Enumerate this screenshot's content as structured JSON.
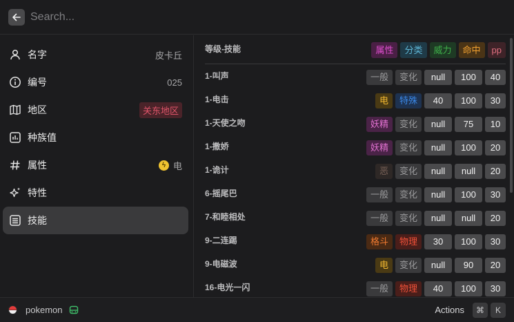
{
  "search": {
    "placeholder": "Search..."
  },
  "left": {
    "items": [
      {
        "label": "名字",
        "value": "皮卡丘",
        "icon": "person-icon"
      },
      {
        "label": "编号",
        "value": "025",
        "icon": "info-icon"
      },
      {
        "label": "地区",
        "value": "关东地区",
        "icon": "map-icon"
      },
      {
        "label": "种族值",
        "value": "",
        "icon": "stats-icon"
      },
      {
        "label": "属性",
        "value": "电",
        "icon": "hash-icon"
      },
      {
        "label": "特性",
        "value": "",
        "icon": "sparkle-icon"
      },
      {
        "label": "技能",
        "value": "",
        "icon": "list-icon"
      }
    ]
  },
  "moves": {
    "header": {
      "title": "等级-技能",
      "tags": [
        "属性",
        "分类",
        "威力",
        "命中",
        "pp"
      ]
    },
    "rows": [
      {
        "name": "1-叫声",
        "type": "一般",
        "category": "变化",
        "power": "null",
        "accuracy": "100",
        "pp": "40"
      },
      {
        "name": "1-电击",
        "type": "电",
        "category": "特殊",
        "power": "40",
        "accuracy": "100",
        "pp": "30"
      },
      {
        "name": "1-天使之吻",
        "type": "妖精",
        "category": "变化",
        "power": "null",
        "accuracy": "75",
        "pp": "10"
      },
      {
        "name": "1-撒娇",
        "type": "妖精",
        "category": "变化",
        "power": "null",
        "accuracy": "100",
        "pp": "20"
      },
      {
        "name": "1-诡计",
        "type": "恶",
        "category": "变化",
        "power": "null",
        "accuracy": "null",
        "pp": "20"
      },
      {
        "name": "6-摇尾巴",
        "type": "一般",
        "category": "变化",
        "power": "null",
        "accuracy": "100",
        "pp": "30"
      },
      {
        "name": "7-和睦相处",
        "type": "一般",
        "category": "变化",
        "power": "null",
        "accuracy": "null",
        "pp": "20"
      },
      {
        "name": "9-二连踢",
        "type": "格斗",
        "category": "物理",
        "power": "30",
        "accuracy": "100",
        "pp": "30"
      },
      {
        "name": "9-电磁波",
        "type": "电",
        "category": "变化",
        "power": "null",
        "accuracy": "90",
        "pp": "20"
      },
      {
        "name": "16-电光一闪",
        "type": "一般",
        "category": "物理",
        "power": "40",
        "accuracy": "100",
        "pp": "30"
      }
    ]
  },
  "colors": {
    "属性": {
      "bg": "#4a1f45",
      "fg": "#e04fd0"
    },
    "分类": {
      "bg": "#1f3a47",
      "fg": "#5fb8d8"
    },
    "威力": {
      "bg": "#1e3a24",
      "fg": "#3fb04a"
    },
    "命中": {
      "bg": "#4a3416",
      "fg": "#f0a030"
    },
    "pp": {
      "bg": "#3e2328",
      "fg": "#e07080"
    },
    "一般": {
      "bg": "#3a3a3c",
      "fg": "#9a9a9c"
    },
    "电": {
      "bg": "#4a3a14",
      "fg": "#f2b830"
    },
    "妖精": {
      "bg": "#4a2347",
      "fg": "#e070d0"
    },
    "恶": {
      "bg": "#2e2826",
      "fg": "#7a6258"
    },
    "格斗": {
      "bg": "#4a2a14",
      "fg": "#f07a30"
    },
    "变化": {
      "bg": "#3a3a3c",
      "fg": "#9a9a9c"
    },
    "特殊": {
      "bg": "#1e3250",
      "fg": "#3a88e8"
    },
    "物理": {
      "bg": "#4a1e1a",
      "fg": "#f05038"
    }
  },
  "bottom": {
    "extension_name": "pokemon",
    "actions_label": "Actions",
    "shortcut": [
      "⌘",
      "K"
    ]
  }
}
